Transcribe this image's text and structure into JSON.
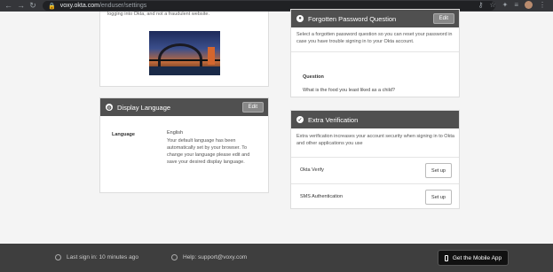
{
  "browser": {
    "url_domain": "voxy.okta.com",
    "url_path": "/enduser/settings"
  },
  "image_panel": {
    "cut_text": "logging into Okta, and not a fraudulent website."
  },
  "display_language": {
    "title": "Display Language",
    "edit_label": "Edit",
    "language_label": "Language",
    "language_value": "English",
    "description": "Your default language has been automatically set by your browser. To change your language please edit and save your desired display language."
  },
  "forgotten_password": {
    "title": "Forgotten Password Question",
    "edit_label": "Edit",
    "description": "Select a forgotten password question so you can reset your password in case you have trouble signing in to your Okta account.",
    "question_label": "Question",
    "question_text": "What is the food you least liked as a child?"
  },
  "extra_verification": {
    "title": "Extra Verification",
    "description": "Extra verification increases your account security when signing in to Okta and other applications you use",
    "factors": [
      {
        "label": "Okta Verify",
        "button": "Set up"
      },
      {
        "label": "SMS Authentication",
        "button": "Set up"
      }
    ]
  },
  "footer": {
    "last_sign_in": "Last sign in: 10 minutes ago",
    "help": "Help: support@voxy.com",
    "mobile_app": "Get the Mobile App"
  }
}
